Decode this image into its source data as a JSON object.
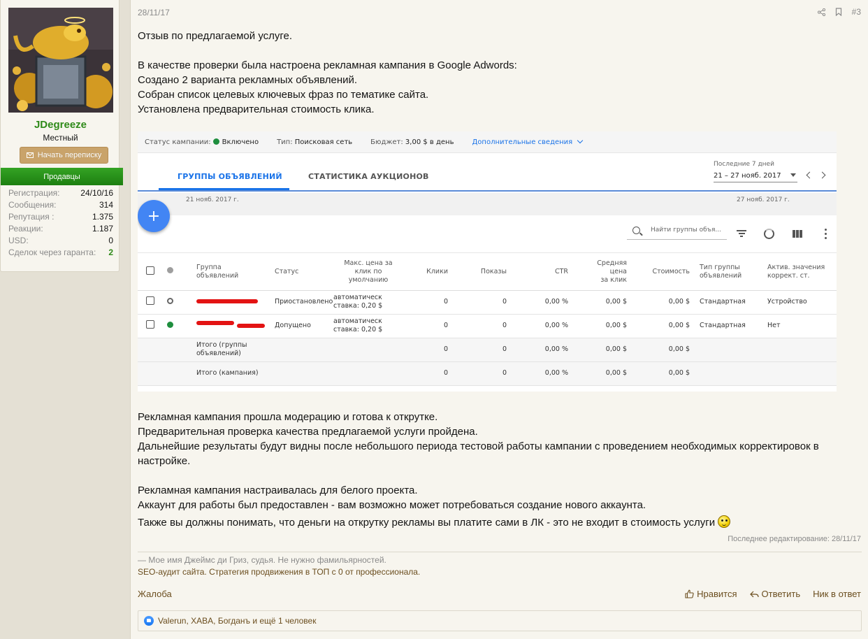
{
  "user": {
    "name": "JDegreeze",
    "title": "Местный",
    "message_button": "Начать переписку",
    "banner": "Продавцы",
    "stats": [
      {
        "label": "Регистрация:",
        "value": "24/10/16"
      },
      {
        "label": "Сообщения:",
        "value": "314"
      },
      {
        "label": "Репутация :",
        "value": "1.375"
      },
      {
        "label": "Реакции:",
        "value": "1.187"
      },
      {
        "label": "USD:",
        "value": "0"
      },
      {
        "label": "Сделок через гаранта:",
        "value": "2"
      }
    ]
  },
  "post": {
    "date": "28/11/17",
    "number": "#3",
    "paragraph1": [
      "Отзыв по предлагаемой услуге."
    ],
    "paragraph2": [
      "В качестве проверки была настроена рекламная кампания в Google Adwords:",
      "Создано 2 варианта рекламных объявлений.",
      "Собран список целевых ключевых фраз по тематике сайта.",
      "Установлена предварительная стоимость клика."
    ],
    "paragraph3": [
      "Рекламная кампания прошла модерацию и готова к открутке.",
      "Предварительная проверка качества предлагаемой услуги пройдена.",
      "Дальнейшие результаты будут видны после небольшого периода тестовой работы кампании с проведением необходимых корректировок в",
      "настройке."
    ],
    "paragraph4": [
      "Рекламная кампания настраивалась для белого проекта.",
      "Аккаунт для работы был предоставлен - вам возможно может потребоваться создание нового аккаунта."
    ],
    "last_line": "Также вы должны понимать, что деньги на открутку рекламы вы платите сами в ЛК - это не входит в стоимость услуги",
    "edit_note": "Последнее редактирование: 28/11/17",
    "signature_quote": "— Мое имя Джеймс ди Гриз, судья. Не нужно фамильярностей.",
    "signature_link": "SEO-аудит сайта. Стратегия продвижения в ТОП с 0 от профессионала.",
    "report": "Жалоба",
    "actions": {
      "like": "Нравится",
      "reply": "Ответить",
      "nick": "Ник в ответ"
    },
    "reactions": "Valerun, XABA, Богданъ и ещё 1 человек"
  },
  "adwords": {
    "status_label": "Статус кампании:",
    "status_value": "Включено",
    "type_label": "Тип:",
    "type_value": "Поисковая сеть",
    "budget_label": "Бюджет:",
    "budget_value": "3,00 $ в день",
    "details_link": "Дополнительные сведения",
    "tab1": "ГРУППЫ ОБЪЯВЛЕНИЙ",
    "tab2": "СТАТИСТИКА АУКЦИОНОВ",
    "range_label": "Последние 7 дней",
    "range_value": "21 – 27 нояб. 2017",
    "date_start": "21 нояб. 2017 г.",
    "date_end": "27 нояб. 2017 г.",
    "search_placeholder": "Найти группы объя...",
    "headers": {
      "group": [
        "Группа",
        "объявлений"
      ],
      "status": "Статус",
      "max_cpc": [
        "Макс. цена за",
        "клик по",
        "умолчанию"
      ],
      "clicks": "Клики",
      "impr": "Показы",
      "ctr": "CTR",
      "avg_cpc": [
        "Средняя цена",
        "за клик"
      ],
      "cost": "Стоимость",
      "type": [
        "Тип группы",
        "объявлений"
      ],
      "active": [
        "Актив. значения",
        "коррект. ст."
      ]
    },
    "rows": [
      {
        "status": "Приостановлено",
        "bid": [
          "автоматическ",
          "ставка: 0,20 $"
        ],
        "clicks": "0",
        "impr": "0",
        "ctr": "0,00 %",
        "avg": "0,00 $",
        "cost": "0,00 $",
        "type": "Стандартная",
        "active": "Устройство"
      },
      {
        "status": "Допущено",
        "bid": [
          "автоматическ",
          "ставка: 0,20 $"
        ],
        "clicks": "0",
        "impr": "0",
        "ctr": "0,00 %",
        "avg": "0,00 $",
        "cost": "0,00 $",
        "type": "Стандартная",
        "active": "Нет"
      }
    ],
    "totals": [
      {
        "label": [
          "Итого (группы",
          "объявлений)"
        ],
        "clicks": "0",
        "impr": "0",
        "ctr": "0,00 %",
        "avg": "0,00 $",
        "cost": "0,00 $"
      },
      {
        "label": [
          "Итого (кампания)"
        ],
        "clicks": "0",
        "impr": "0",
        "ctr": "0,00 %",
        "avg": "0,00 $",
        "cost": "0,00 $"
      }
    ]
  }
}
